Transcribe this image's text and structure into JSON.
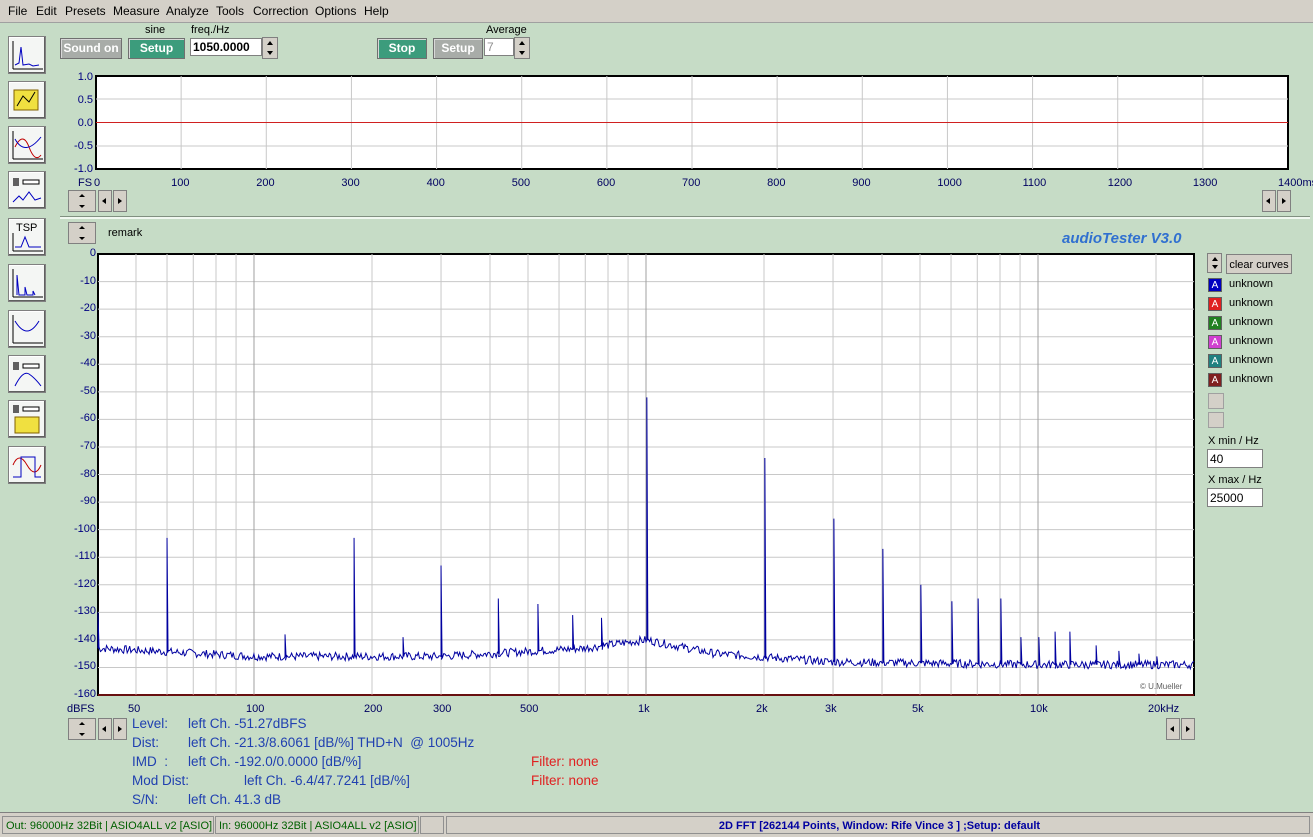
{
  "menu": [
    "File",
    "Edit",
    "Presets",
    "Measure",
    "Analyze",
    "Tools",
    "Correction",
    "Options",
    "Help"
  ],
  "generator": {
    "sound_on_label": "Sound on",
    "waveform_label": "sine",
    "setup_label": "Setup",
    "freq_label": "freq./Hz",
    "freq_value": "1050.0000"
  },
  "analyzer": {
    "stop_label": "Stop",
    "setup_label": "Setup",
    "average_label": "Average",
    "average_value": "7"
  },
  "scope": {
    "y_ticks": [
      "1.0",
      "0.5",
      "0.0",
      "-0.5",
      "-1.0"
    ],
    "fs_label": "FS",
    "x_ticks": [
      "0",
      "100",
      "200",
      "300",
      "400",
      "500",
      "600",
      "700",
      "800",
      "900",
      "1000",
      "1100",
      "1200",
      "1300",
      "1400ms"
    ]
  },
  "fft": {
    "remark_label": "remark",
    "brand": "audioTester  V3.0",
    "copyright": "© U.Mueller",
    "y_unit": "dBFS",
    "y_ticks": [
      "0",
      "-10",
      "-20",
      "-30",
      "-40",
      "-50",
      "-60",
      "-70",
      "-80",
      "-90",
      "-100",
      "-110",
      "-120",
      "-130",
      "-140",
      "-150",
      "-160"
    ],
    "x_ticks": [
      "50",
      "100",
      "200",
      "300",
      "500",
      "1k",
      "2k",
      "3k",
      "5k",
      "10k",
      "20kHz"
    ],
    "clear_curves_label": "clear curves",
    "legend": [
      {
        "letter": "A",
        "label": "unknown",
        "color": "#0000c0"
      },
      {
        "letter": "A",
        "label": "unknown",
        "color": "#e02020"
      },
      {
        "letter": "A",
        "label": "unknown",
        "color": "#208020"
      },
      {
        "letter": "A",
        "label": "unknown",
        "color": "#d040d0"
      },
      {
        "letter": "A",
        "label": "unknown",
        "color": "#208080"
      },
      {
        "letter": "A",
        "label": "unknown",
        "color": "#802020"
      }
    ],
    "xmin_label": "X min / Hz",
    "xmin_value": "40",
    "xmax_label": "X max / Hz",
    "xmax_value": "25000"
  },
  "measurements": {
    "level_key": "Level:",
    "level_val": "left Ch. -51.27dBFS",
    "dist_key": "Dist:",
    "dist_val": "left Ch. -21.3/8.6061 [dB/%] THD+N  @ 1005Hz",
    "imd_key": "IMD  :",
    "imd_val": "left Ch. -192.0/0.0000 [dB/%]",
    "imd_filter": "Filter: none",
    "moddist_key": "Mod Dist:",
    "moddist_val": "left Ch. -6.4/47.7241 [dB/%]",
    "moddist_filter": "Filter: none",
    "sn_key": "S/N:",
    "sn_val": "left Ch. 41.3 dB"
  },
  "status": {
    "out": "Out: 96000Hz 32Bit  | ASIO4ALL v2 [ASIO]",
    "in": "In: 96000Hz 32Bit  | ASIO4ALL v2 [ASIO]",
    "fft_info": "2D FFT [262144 Points, Window: Rife Vince 3 ] ;Setup:  default"
  },
  "chart_data": [
    {
      "type": "line",
      "title": "",
      "x_unit": "ms",
      "xlim": [
        0,
        1400
      ],
      "ylim": [
        -1.0,
        1.0
      ],
      "series": [
        {
          "x": [
            0,
            1400
          ],
          "y": [
            0,
            0
          ],
          "color": "#d02020"
        }
      ]
    },
    {
      "type": "line",
      "xlabel": "",
      "ylabel": "dBFS",
      "x_scale": "log",
      "xlim": [
        40,
        25000
      ],
      "ylim": [
        -160,
        0
      ],
      "grid": true,
      "peaks": [
        {
          "x": 40,
          "y": -130
        },
        {
          "x": 60,
          "y": -103
        },
        {
          "x": 120,
          "y": -138
        },
        {
          "x": 180,
          "y": -103
        },
        {
          "x": 240,
          "y": -139
        },
        {
          "x": 300,
          "y": -113
        },
        {
          "x": 420,
          "y": -125
        },
        {
          "x": 530,
          "y": -127
        },
        {
          "x": 650,
          "y": -131
        },
        {
          "x": 770,
          "y": -132
        },
        {
          "x": 1005,
          "y": -52
        },
        {
          "x": 2010,
          "y": -74
        },
        {
          "x": 3015,
          "y": -96
        },
        {
          "x": 4020,
          "y": -107
        },
        {
          "x": 5025,
          "y": -120
        },
        {
          "x": 6030,
          "y": -126
        },
        {
          "x": 7035,
          "y": -125
        },
        {
          "x": 8040,
          "y": -125
        },
        {
          "x": 9045,
          "y": -139
        },
        {
          "x": 10050,
          "y": -139
        },
        {
          "x": 11055,
          "y": -137
        },
        {
          "x": 12060,
          "y": -137
        },
        {
          "x": 14070,
          "y": -142
        },
        {
          "x": 16080,
          "y": -144
        },
        {
          "x": 18090,
          "y": -145
        },
        {
          "x": 20100,
          "y": -146
        }
      ],
      "noise_floor": [
        {
          "x": 40,
          "y": -143
        },
        {
          "x": 100,
          "y": -146
        },
        {
          "x": 300,
          "y": -146
        },
        {
          "x": 700,
          "y": -143
        },
        {
          "x": 1000,
          "y": -140
        },
        {
          "x": 1500,
          "y": -145
        },
        {
          "x": 3000,
          "y": -148
        },
        {
          "x": 10000,
          "y": -149
        },
        {
          "x": 25000,
          "y": -149
        }
      ],
      "series_color": "#0000a0"
    }
  ]
}
